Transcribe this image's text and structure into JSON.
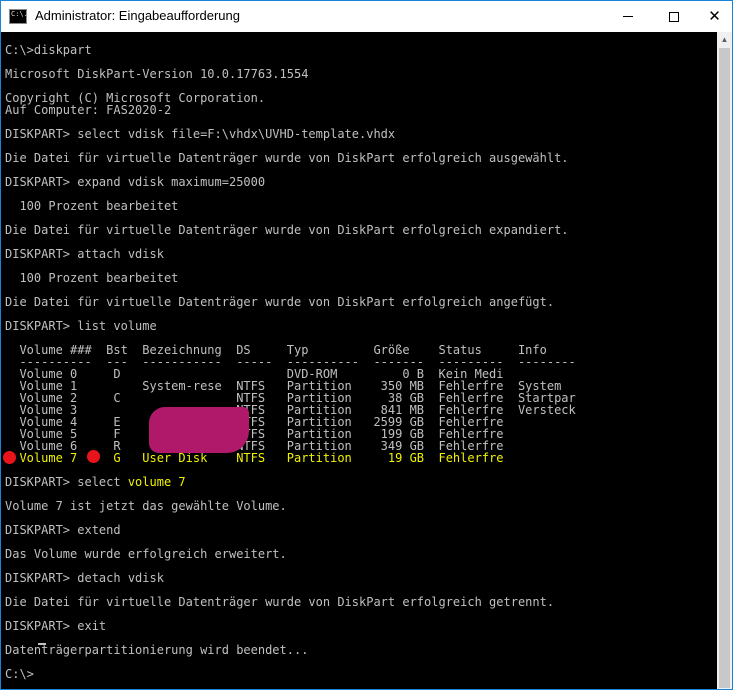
{
  "window": {
    "title": "Administrator: Eingabeaufforderung",
    "icon": "cmd-icon",
    "icon_text": "C:\\.",
    "minimize_icon": "minimize-icon",
    "maximize_icon": "maximize-icon",
    "close_glyph": "✕"
  },
  "console": {
    "lines": [
      "C:\\>diskpart",
      "Microsoft DiskPart-Version 10.0.17763.1554",
      "Copyright (C) Microsoft Corporation.",
      "Auf Computer: FAS2020-2",
      "DISKPART> select vdisk file=F:\\vhdx\\UVHD-template.vhdx",
      "Die Datei für virtuelle Datenträger wurde von DiskPart erfolgreich ausgewählt.",
      "DISKPART> expand vdisk maximum=25000",
      "  100 Prozent bearbeitet",
      "Die Datei für virtuelle Datenträger wurde von DiskPart erfolgreich expandiert.",
      "DISKPART> attach vdisk",
      "  100 Prozent bearbeitet",
      "Die Datei für virtuelle Datenträger wurde von DiskPart erfolgreich angefügt.",
      "DISKPART> list volume",
      "  Volume ###  Bst  Bezeichnung  DS     Typ         Größe    Status     Info",
      "  ----------  ---  -----------  -----  ----------  -------  ---------  --------",
      "  Volume 0     D                       DVD-ROM         0 B  Kein Medi",
      "  Volume 1         System-rese  NTFS   Partition    350 MB  Fehlerfre  System",
      "  Volume 2     C                NTFS   Partition     38 GB  Fehlerfre  Startpar",
      "  Volume 3                      NTFS   Partition    841 MB  Fehlerfre  Versteck",
      "  Volume 4     E                NTFS   Partition   2599 GB  Fehlerfre",
      "  Volume 5     F                NTFS   Partition    199 GB  Fehlerfre",
      "  Volume 6     R                NTFS   Partition    349 GB  Fehlerfre",
      "  Volume 7     G   User Disk    NTFS   Partition     19 GB  Fehlerfre",
      "Volume 7 ist jetzt das gewählte Volume.",
      "DISKPART> extend",
      "Das Volume wurde erfolgreich erweitert.",
      "DISKPART> detach vdisk",
      "Die Datei für virtuelle Datenträger wurde von DiskPart erfolgreich getrennt.",
      "DISKPART> exit",
      "Datenträgerpartitionierung wird beendet...",
      "C:\\>"
    ],
    "select_prefix": "DISKPART> select ",
    "select_highlight": "volume 7",
    "highlight_color": "#f2f200",
    "text_color": "#c0c0c0",
    "background_color": "#000000"
  },
  "annotations": {
    "redaction_color": "#b0186a",
    "marker_color": "#e8141b"
  }
}
